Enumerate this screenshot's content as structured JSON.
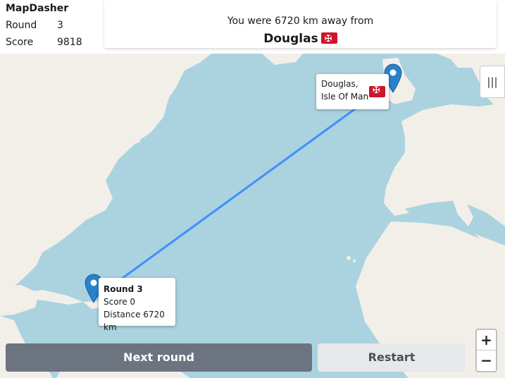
{
  "app": {
    "title": "MapDasher"
  },
  "stats": {
    "round_label": "Round",
    "round_value": "3",
    "score_label": "Score",
    "score_value": "9818"
  },
  "result": {
    "message": "You were 6720 km away from",
    "city": "Douglas"
  },
  "map": {
    "layers_icon": "layers-icon",
    "destination_popup": {
      "line1": "Douglas,",
      "line2": "Isle Of Man"
    },
    "guess_popup": {
      "title": "Round 3",
      "score": "Score 0",
      "distance": "Distance 6720 km"
    },
    "zoom_in_label": "+",
    "zoom_out_label": "−",
    "colors": {
      "water": "#aad3df",
      "land": "#f2efe9",
      "route": "#3388ff",
      "marker": "#2a81cb"
    }
  },
  "actions": {
    "next_round": "Next round",
    "restart": "Restart"
  }
}
